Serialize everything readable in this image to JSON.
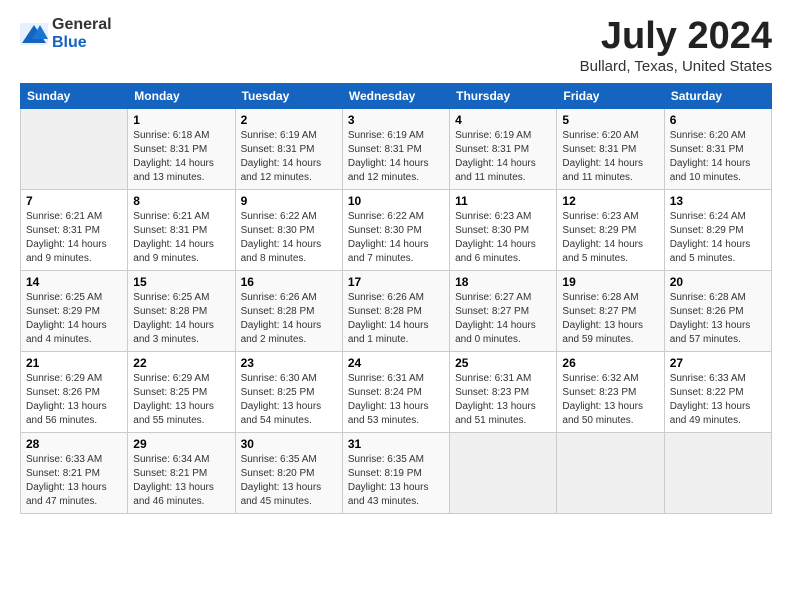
{
  "logo": {
    "text_general": "General",
    "text_blue": "Blue"
  },
  "title": {
    "month_year": "July 2024",
    "location": "Bullard, Texas, United States"
  },
  "weekdays": [
    "Sunday",
    "Monday",
    "Tuesday",
    "Wednesday",
    "Thursday",
    "Friday",
    "Saturday"
  ],
  "weeks": [
    [
      {
        "day": "",
        "text": ""
      },
      {
        "day": "1",
        "text": "Sunrise: 6:18 AM\nSunset: 8:31 PM\nDaylight: 14 hours\nand 13 minutes."
      },
      {
        "day": "2",
        "text": "Sunrise: 6:19 AM\nSunset: 8:31 PM\nDaylight: 14 hours\nand 12 minutes."
      },
      {
        "day": "3",
        "text": "Sunrise: 6:19 AM\nSunset: 8:31 PM\nDaylight: 14 hours\nand 12 minutes."
      },
      {
        "day": "4",
        "text": "Sunrise: 6:19 AM\nSunset: 8:31 PM\nDaylight: 14 hours\nand 11 minutes."
      },
      {
        "day": "5",
        "text": "Sunrise: 6:20 AM\nSunset: 8:31 PM\nDaylight: 14 hours\nand 11 minutes."
      },
      {
        "day": "6",
        "text": "Sunrise: 6:20 AM\nSunset: 8:31 PM\nDaylight: 14 hours\nand 10 minutes."
      }
    ],
    [
      {
        "day": "7",
        "text": "Sunrise: 6:21 AM\nSunset: 8:31 PM\nDaylight: 14 hours\nand 9 minutes."
      },
      {
        "day": "8",
        "text": "Sunrise: 6:21 AM\nSunset: 8:31 PM\nDaylight: 14 hours\nand 9 minutes."
      },
      {
        "day": "9",
        "text": "Sunrise: 6:22 AM\nSunset: 8:30 PM\nDaylight: 14 hours\nand 8 minutes."
      },
      {
        "day": "10",
        "text": "Sunrise: 6:22 AM\nSunset: 8:30 PM\nDaylight: 14 hours\nand 7 minutes."
      },
      {
        "day": "11",
        "text": "Sunrise: 6:23 AM\nSunset: 8:30 PM\nDaylight: 14 hours\nand 6 minutes."
      },
      {
        "day": "12",
        "text": "Sunrise: 6:23 AM\nSunset: 8:29 PM\nDaylight: 14 hours\nand 5 minutes."
      },
      {
        "day": "13",
        "text": "Sunrise: 6:24 AM\nSunset: 8:29 PM\nDaylight: 14 hours\nand 5 minutes."
      }
    ],
    [
      {
        "day": "14",
        "text": "Sunrise: 6:25 AM\nSunset: 8:29 PM\nDaylight: 14 hours\nand 4 minutes."
      },
      {
        "day": "15",
        "text": "Sunrise: 6:25 AM\nSunset: 8:28 PM\nDaylight: 14 hours\nand 3 minutes."
      },
      {
        "day": "16",
        "text": "Sunrise: 6:26 AM\nSunset: 8:28 PM\nDaylight: 14 hours\nand 2 minutes."
      },
      {
        "day": "17",
        "text": "Sunrise: 6:26 AM\nSunset: 8:28 PM\nDaylight: 14 hours\nand 1 minute."
      },
      {
        "day": "18",
        "text": "Sunrise: 6:27 AM\nSunset: 8:27 PM\nDaylight: 14 hours\nand 0 minutes."
      },
      {
        "day": "19",
        "text": "Sunrise: 6:28 AM\nSunset: 8:27 PM\nDaylight: 13 hours\nand 59 minutes."
      },
      {
        "day": "20",
        "text": "Sunrise: 6:28 AM\nSunset: 8:26 PM\nDaylight: 13 hours\nand 57 minutes."
      }
    ],
    [
      {
        "day": "21",
        "text": "Sunrise: 6:29 AM\nSunset: 8:26 PM\nDaylight: 13 hours\nand 56 minutes."
      },
      {
        "day": "22",
        "text": "Sunrise: 6:29 AM\nSunset: 8:25 PM\nDaylight: 13 hours\nand 55 minutes."
      },
      {
        "day": "23",
        "text": "Sunrise: 6:30 AM\nSunset: 8:25 PM\nDaylight: 13 hours\nand 54 minutes."
      },
      {
        "day": "24",
        "text": "Sunrise: 6:31 AM\nSunset: 8:24 PM\nDaylight: 13 hours\nand 53 minutes."
      },
      {
        "day": "25",
        "text": "Sunrise: 6:31 AM\nSunset: 8:23 PM\nDaylight: 13 hours\nand 51 minutes."
      },
      {
        "day": "26",
        "text": "Sunrise: 6:32 AM\nSunset: 8:23 PM\nDaylight: 13 hours\nand 50 minutes."
      },
      {
        "day": "27",
        "text": "Sunrise: 6:33 AM\nSunset: 8:22 PM\nDaylight: 13 hours\nand 49 minutes."
      }
    ],
    [
      {
        "day": "28",
        "text": "Sunrise: 6:33 AM\nSunset: 8:21 PM\nDaylight: 13 hours\nand 47 minutes."
      },
      {
        "day": "29",
        "text": "Sunrise: 6:34 AM\nSunset: 8:21 PM\nDaylight: 13 hours\nand 46 minutes."
      },
      {
        "day": "30",
        "text": "Sunrise: 6:35 AM\nSunset: 8:20 PM\nDaylight: 13 hours\nand 45 minutes."
      },
      {
        "day": "31",
        "text": "Sunrise: 6:35 AM\nSunset: 8:19 PM\nDaylight: 13 hours\nand 43 minutes."
      },
      {
        "day": "",
        "text": ""
      },
      {
        "day": "",
        "text": ""
      },
      {
        "day": "",
        "text": ""
      }
    ]
  ]
}
